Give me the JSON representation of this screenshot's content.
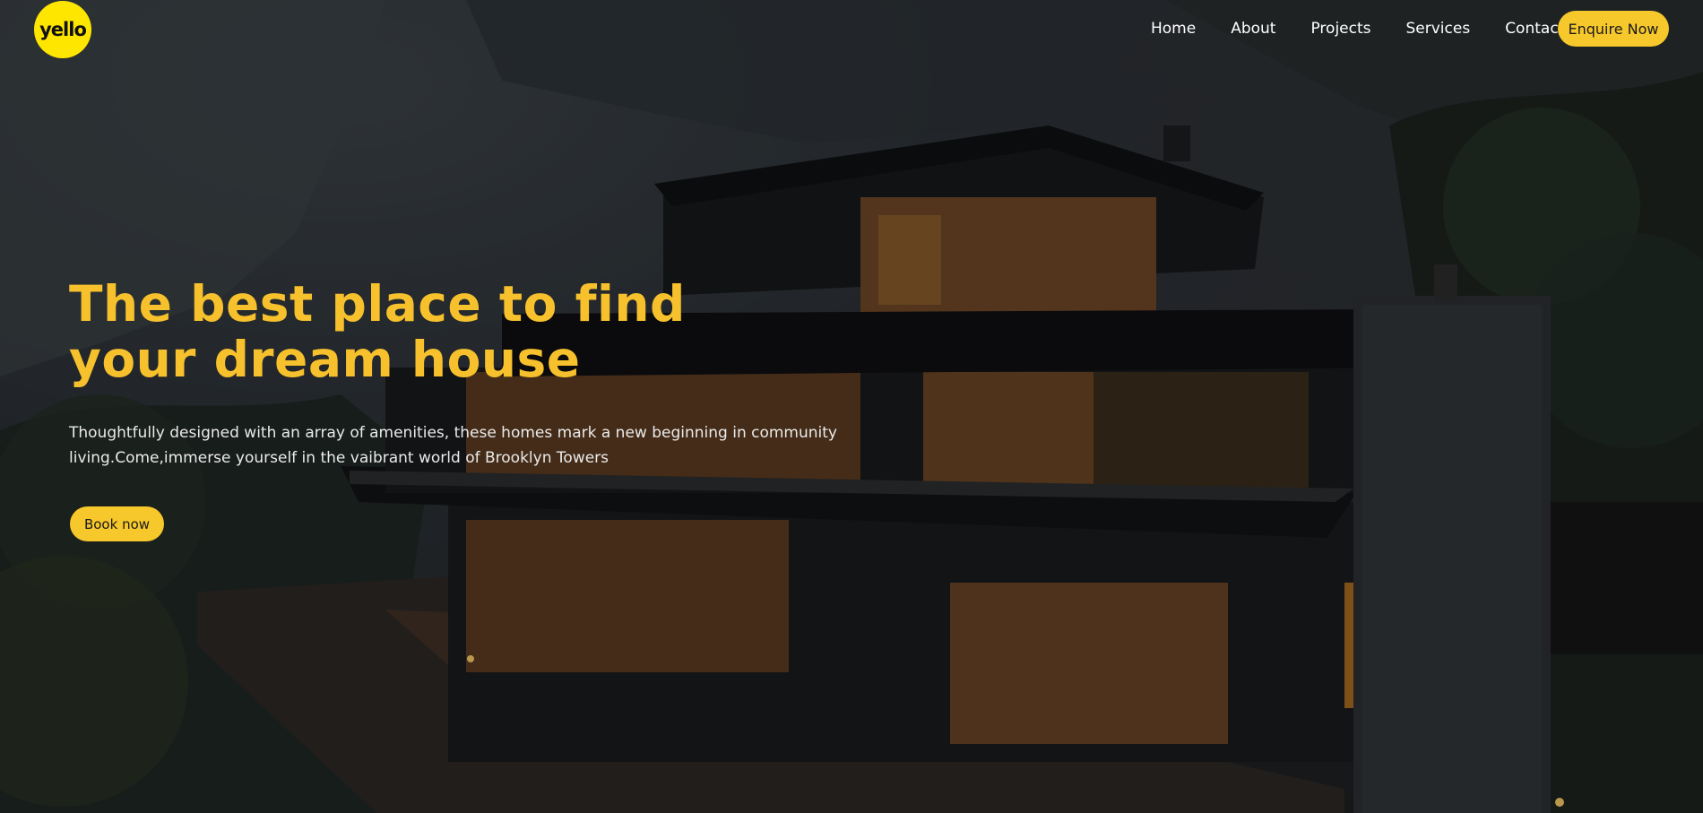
{
  "brand": {
    "logo_text": "yello"
  },
  "nav": {
    "items": [
      {
        "label": "Home"
      },
      {
        "label": "About"
      },
      {
        "label": "Projects"
      },
      {
        "label": "Services"
      },
      {
        "label": "Contact"
      }
    ],
    "cta_label": "Enquire Now"
  },
  "hero": {
    "headline": "The best place to find your dream house",
    "description": "Thoughtfully designed with an array of amenities, these homes mark a new beginning in community living.Come,immerse yourself in the vaibrant world of Brooklyn Towers",
    "button_label": "Book now"
  },
  "colors": {
    "accent": "#f7c82b",
    "logo": "#ffe600",
    "headline": "#f6c12c"
  }
}
